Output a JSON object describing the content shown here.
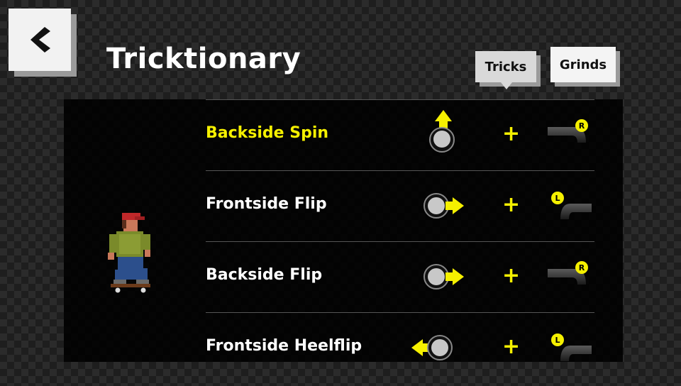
{
  "header": {
    "title": "Tricktionary",
    "back_icon": "chevron-left-icon"
  },
  "tabs": [
    {
      "label": "Tricks",
      "selected": true
    },
    {
      "label": "Grinds",
      "selected": false
    }
  ],
  "tricks": [
    {
      "name": "Backside Spin",
      "direction": "up",
      "button": "R",
      "active": true
    },
    {
      "name": "Frontside Flip",
      "direction": "right",
      "button": "L",
      "active": false
    },
    {
      "name": "Backside Flip",
      "direction": "right",
      "button": "R",
      "active": false
    },
    {
      "name": "Frontside Heelflip",
      "direction": "left",
      "button": "L",
      "active": false
    }
  ],
  "combo_symbol": "+",
  "colors": {
    "highlight": "#f5f000",
    "text": "#ffffff",
    "panel": "#000000"
  }
}
